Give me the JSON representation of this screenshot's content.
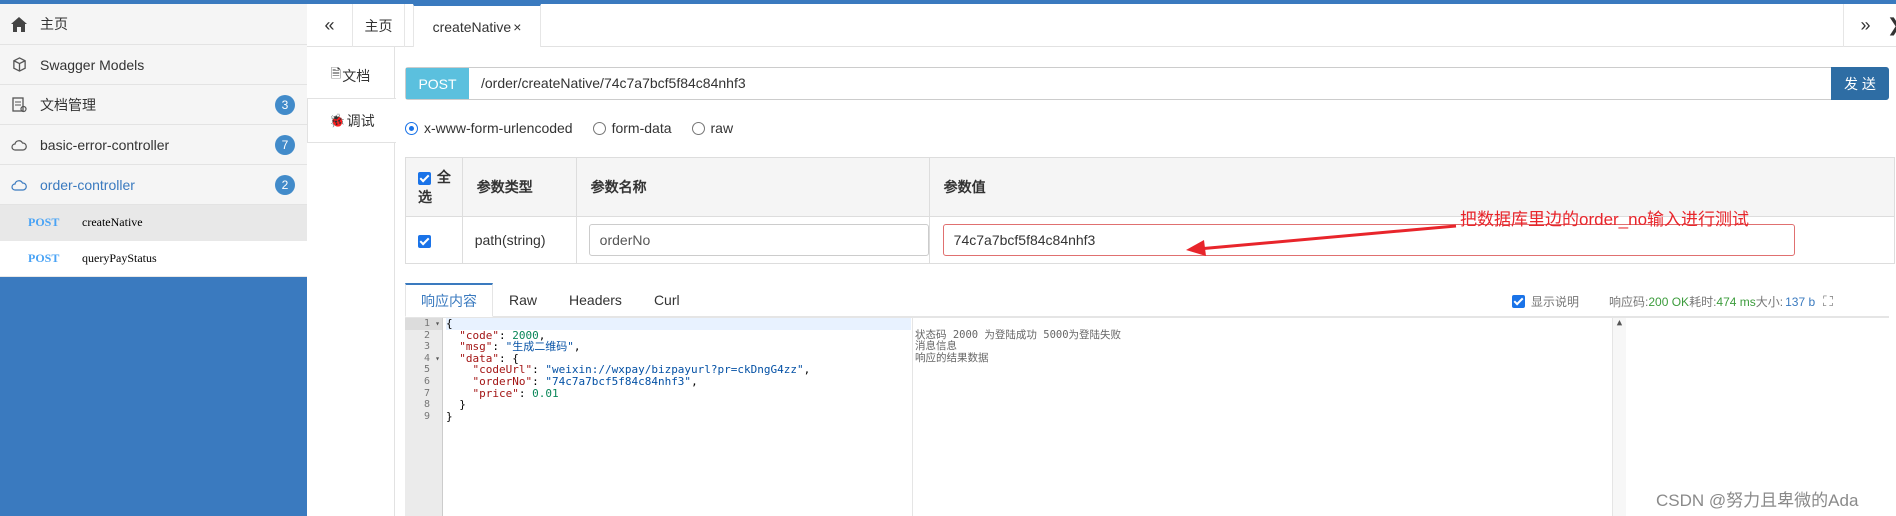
{
  "sidebar": {
    "items": [
      {
        "label": "主页",
        "icon": "home-icon"
      },
      {
        "label": "Swagger Models",
        "icon": "cube-icon"
      },
      {
        "label": "文档管理",
        "icon": "document-icon",
        "badge": "3"
      },
      {
        "label": "basic-error-controller",
        "icon": "cloud-icon",
        "badge": "7"
      },
      {
        "label": "order-controller",
        "icon": "cloud-icon",
        "badge": "2"
      }
    ],
    "operations": [
      {
        "method": "POST",
        "name": "createNative"
      },
      {
        "method": "POST",
        "name": "queryPayStatus"
      }
    ]
  },
  "tabs": {
    "home": "主页",
    "active": "createNative",
    "close": "×"
  },
  "doc_tabs": {
    "doc": "文档",
    "debug": "调试"
  },
  "request": {
    "method": "POST",
    "url": "/order/createNative/74c7a7bcf5f84c84nhf3",
    "send": "发 送",
    "content_types": [
      "x-www-form-urlencoded",
      "form-data",
      "raw"
    ]
  },
  "params": {
    "headers": [
      "全选",
      "参数类型",
      "参数名称",
      "参数值"
    ],
    "rows": [
      {
        "type": "path(string)",
        "name": "orderNo",
        "value": "74c7a7bcf5f84c84nhf3"
      }
    ]
  },
  "annotation": "把数据库里边的order_no输入进行测试",
  "response": {
    "tabs": [
      "响应内容",
      "Raw",
      "Headers",
      "Curl"
    ],
    "show_desc": "显示说明",
    "code_label": "响应码:",
    "code_value": "200 OK",
    "time_label": "耗时:",
    "time_value": "474 ms",
    "size_label": "大小:",
    "size_value": "137 b",
    "line_numbers": [
      "1",
      "2",
      "3",
      "4",
      "5",
      "6",
      "7",
      "8",
      "9"
    ],
    "body": {
      "open": "{",
      "code_key": "\"code\"",
      "code_val": "2000",
      "msg_key": "\"msg\"",
      "msg_val": "\"生成二维码\"",
      "data_key": "\"data\"",
      "codeUrl_key": "\"codeUrl\"",
      "codeUrl_val": "\"weixin://wxpay/bizpayurl?pr=ckDngG4zz\"",
      "orderNo_key": "\"orderNo\"",
      "orderNo_val": "\"74c7a7bcf5f84c84nhf3\"",
      "price_key": "\"price\"",
      "price_val": "0.01",
      "inner_close": "}",
      "close": "}"
    },
    "descriptions": [
      "状态码 2000 为登陆成功 5000为登陆失败",
      "消息信息",
      "响应的结果数据"
    ]
  },
  "watermark": "CSDN @努力且卑微的Ada"
}
